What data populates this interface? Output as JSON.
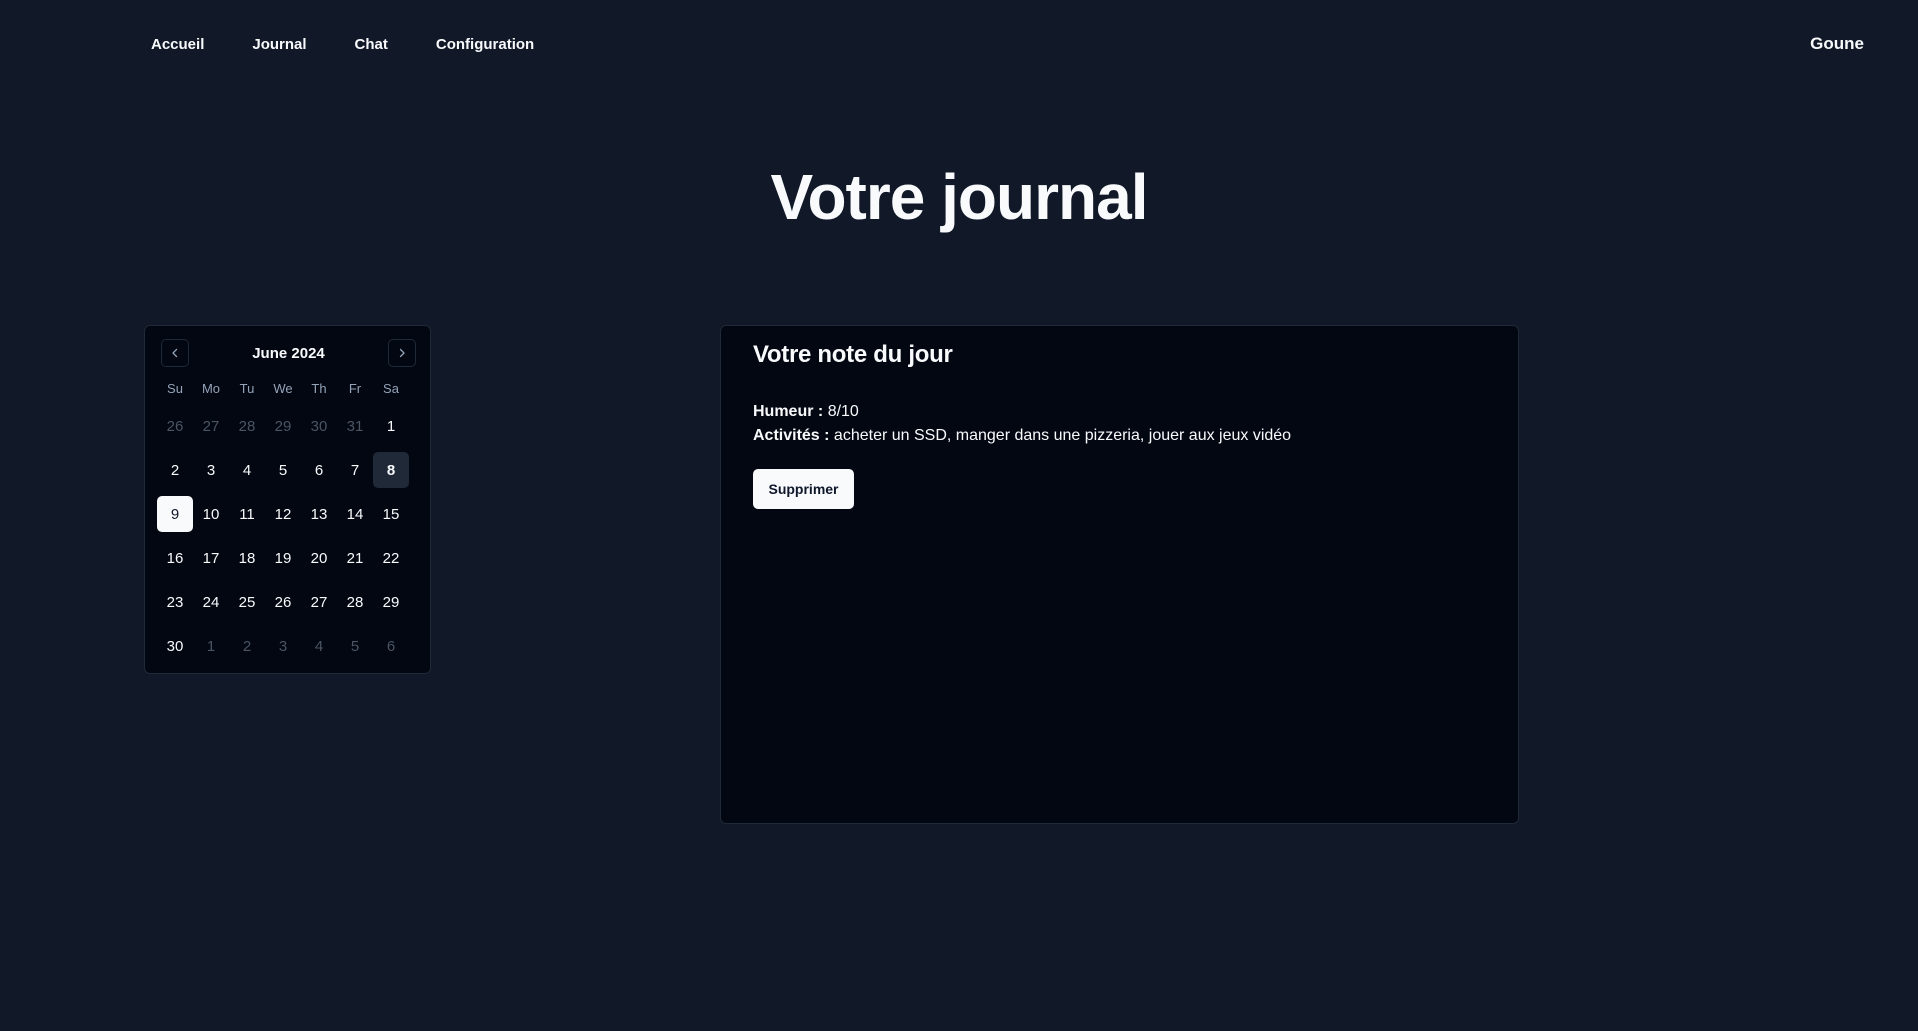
{
  "nav": {
    "links": [
      "Accueil",
      "Journal",
      "Chat",
      "Configuration"
    ],
    "username": "Goune"
  },
  "page": {
    "title": "Votre journal"
  },
  "calendar": {
    "month_label": "June 2024",
    "prev_icon": "chevron-left-icon",
    "next_icon": "chevron-right-icon",
    "weekdays": [
      "Su",
      "Mo",
      "Tu",
      "We",
      "Th",
      "Fr",
      "Sa"
    ],
    "days": [
      {
        "label": "26",
        "outside": true
      },
      {
        "label": "27",
        "outside": true
      },
      {
        "label": "28",
        "outside": true
      },
      {
        "label": "29",
        "outside": true
      },
      {
        "label": "30",
        "outside": true
      },
      {
        "label": "31",
        "outside": true
      },
      {
        "label": "1"
      },
      {
        "label": "2"
      },
      {
        "label": "3"
      },
      {
        "label": "4"
      },
      {
        "label": "5"
      },
      {
        "label": "6"
      },
      {
        "label": "7"
      },
      {
        "label": "8",
        "today": true
      },
      {
        "label": "9",
        "selected": true
      },
      {
        "label": "10"
      },
      {
        "label": "11"
      },
      {
        "label": "12"
      },
      {
        "label": "13"
      },
      {
        "label": "14"
      },
      {
        "label": "15"
      },
      {
        "label": "16"
      },
      {
        "label": "17"
      },
      {
        "label": "18"
      },
      {
        "label": "19"
      },
      {
        "label": "20"
      },
      {
        "label": "21"
      },
      {
        "label": "22"
      },
      {
        "label": "23"
      },
      {
        "label": "24"
      },
      {
        "label": "25"
      },
      {
        "label": "26"
      },
      {
        "label": "27"
      },
      {
        "label": "28"
      },
      {
        "label": "29"
      },
      {
        "label": "30"
      },
      {
        "label": "1",
        "outside": true
      },
      {
        "label": "2",
        "outside": true
      },
      {
        "label": "3",
        "outside": true
      },
      {
        "label": "4",
        "outside": true
      },
      {
        "label": "5",
        "outside": true
      },
      {
        "label": "6",
        "outside": true
      }
    ]
  },
  "note": {
    "title": "Votre note du jour",
    "mood_label": "Humeur :",
    "mood_value": "8/10",
    "activities_label": "Activités :",
    "activities_value": "acheter un SSD, manger dans une pizzeria, jouer aux jeux vidéo",
    "delete_label": "Supprimer"
  },
  "colors": {
    "background": "#111827",
    "card": "#030712",
    "text": "#f8fafc",
    "muted": "#4b5563"
  }
}
